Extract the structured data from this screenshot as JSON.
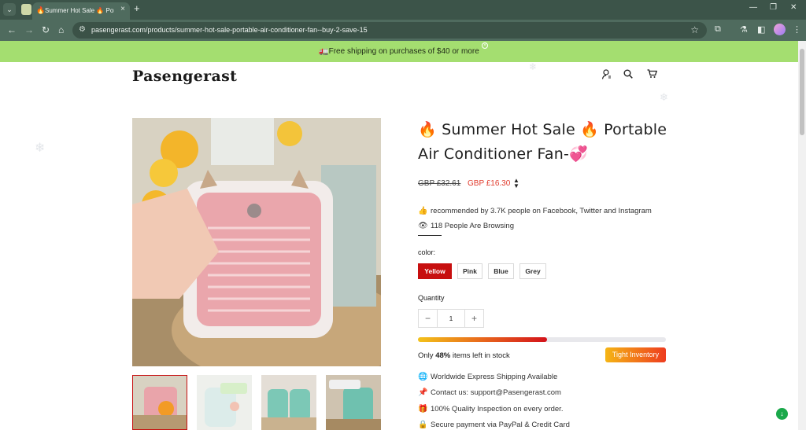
{
  "browser": {
    "tab_title": "Summer Hot Sale 🔥 Porta",
    "tab_close": "×",
    "new_tab": "+",
    "url": "pasengerast.com/products/summer-hot-sale-portable-air-conditioner-fan--buy-2-save-15"
  },
  "announcement": {
    "text": "🚛Free shipping on purchases of $40 or more"
  },
  "header": {
    "logo": "Pasengerast",
    "icons": [
      "account-icon",
      "search-icon",
      "cart-icon"
    ]
  },
  "product": {
    "title": "🔥 Summer Hot Sale 🔥 Portable Air Conditioner Fan-💞",
    "price_old": "GBP £32.61",
    "price_new": "GBP £16.30",
    "recommend": "recommended by 3.7K people on Facebook, Twitter and Instagram",
    "browsing": "118 People Are Browsing",
    "color_label": "color:",
    "colors": [
      "Yellow",
      "Pink",
      "Blue",
      "Grey"
    ],
    "selected_color": "Yellow",
    "quantity_label": "Quantity",
    "quantity_value": "1",
    "stock_prefix": "Only ",
    "stock_percent_text": "48%",
    "stock_suffix": " items left in stock",
    "stock_fraction": 0.52,
    "inventory_badge": "Tight Inventory",
    "features": [
      "Worldwide Express Shipping Available",
      "Contact us: support@Pasengerast.com",
      "100% Quality Inspection on every order.",
      "Secure payment via PayPal & Credit Card"
    ]
  },
  "colors": {
    "accent_red": "#c70f0f",
    "sale_red": "#e03a2c",
    "announce_green": "#a4de70"
  }
}
